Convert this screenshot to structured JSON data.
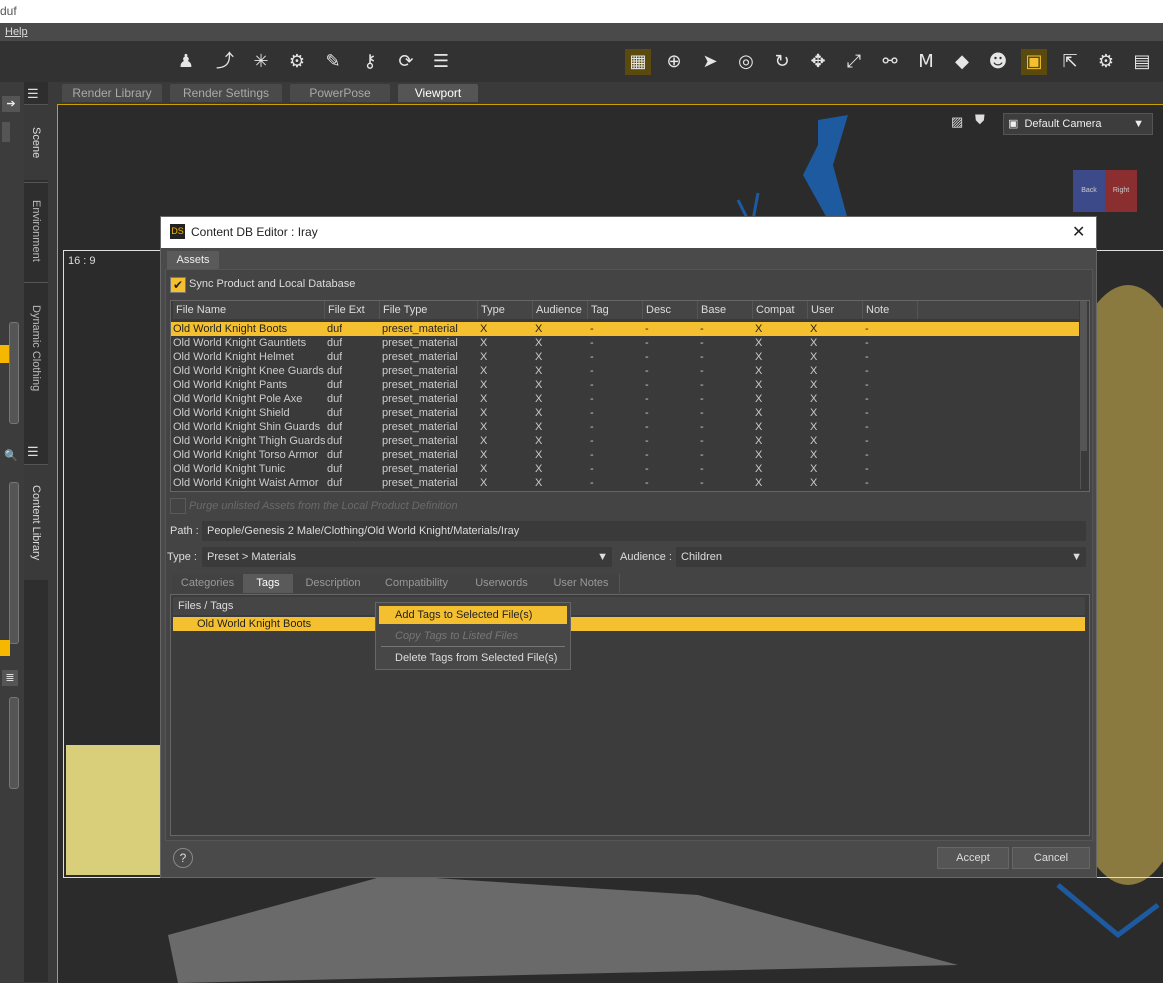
{
  "app": {
    "title_fragment": "duf",
    "menu_help": "Help"
  },
  "toolbar_icons": [
    "figure-add-icon",
    "bone-tool-icon",
    "light-sparkle-icon",
    "gear-light-icon",
    "pin-tool-icon",
    "joint-editor-icon",
    "target-rotate-icon",
    "align-icon",
    "grid-snap-icon",
    "universal-tool-icon",
    "select-tool-icon",
    "node-rotate-icon",
    "rotate-icon",
    "translate-icon",
    "scale-icon",
    "bone-select-icon",
    "geometry-editor-icon",
    "region-navigator-icon",
    "surface-select-icon",
    "camera-tool-icon",
    "node-select-icon",
    "tool-settings-icon",
    "render-icon"
  ],
  "left_tabs": [
    "Scene",
    "Environment",
    "Dynamic Clothing",
    "Content Library"
  ],
  "main_tabs": [
    {
      "label": "Render Library"
    },
    {
      "label": "Render Settings"
    },
    {
      "label": "PowerPose"
    },
    {
      "label": "Viewport"
    }
  ],
  "viewport": {
    "aspect_label": "16 : 9",
    "camera": "Default Camera",
    "cube_left": "Back",
    "cube_right": "Right"
  },
  "dialog": {
    "title": "Content DB Editor : Iray",
    "logo": "DS",
    "tab": "Assets",
    "sync_label": "Sync Product and Local Database",
    "columns": [
      "File Name",
      "File Ext",
      "File Type",
      "Type",
      "Audience",
      "Tag",
      "Desc",
      "Base",
      "Compat",
      "User",
      "Note"
    ],
    "rows": [
      [
        "Old World Knight Boots",
        "duf",
        "preset_material",
        "X",
        "X",
        "-",
        "-",
        "-",
        "X",
        "X",
        "-"
      ],
      [
        "Old World Knight Gauntlets",
        "duf",
        "preset_material",
        "X",
        "X",
        "-",
        "-",
        "-",
        "X",
        "X",
        "-"
      ],
      [
        "Old World Knight Helmet",
        "duf",
        "preset_material",
        "X",
        "X",
        "-",
        "-",
        "-",
        "X",
        "X",
        "-"
      ],
      [
        "Old World Knight Knee Guards",
        "duf",
        "preset_material",
        "X",
        "X",
        "-",
        "-",
        "-",
        "X",
        "X",
        "-"
      ],
      [
        "Old World Knight Pants",
        "duf",
        "preset_material",
        "X",
        "X",
        "-",
        "-",
        "-",
        "X",
        "X",
        "-"
      ],
      [
        "Old World Knight Pole Axe",
        "duf",
        "preset_material",
        "X",
        "X",
        "-",
        "-",
        "-",
        "X",
        "X",
        "-"
      ],
      [
        "Old World Knight Shield",
        "duf",
        "preset_material",
        "X",
        "X",
        "-",
        "-",
        "-",
        "X",
        "X",
        "-"
      ],
      [
        "Old World Knight Shin Guards",
        "duf",
        "preset_material",
        "X",
        "X",
        "-",
        "-",
        "-",
        "X",
        "X",
        "-"
      ],
      [
        "Old World Knight Thigh Guards",
        "duf",
        "preset_material",
        "X",
        "X",
        "-",
        "-",
        "-",
        "X",
        "X",
        "-"
      ],
      [
        "Old World Knight Torso Armor",
        "duf",
        "preset_material",
        "X",
        "X",
        "-",
        "-",
        "-",
        "X",
        "X",
        "-"
      ],
      [
        "Old World Knight Tunic",
        "duf",
        "preset_material",
        "X",
        "X",
        "-",
        "-",
        "-",
        "X",
        "X",
        "-"
      ],
      [
        "Old World Knight Waist Armor",
        "duf",
        "preset_material",
        "X",
        "X",
        "-",
        "-",
        "-",
        "X",
        "X",
        "-"
      ]
    ],
    "selected_row": 0,
    "purge_label": "Purge unlisted Assets from the Local Product Definition",
    "path_label": "Path :",
    "path_value": "People/Genesis 2 Male/Clothing/Old World Knight/Materials/Iray",
    "type_label": "Type :",
    "type_value": "Preset > Materials",
    "audience_label": "Audience :",
    "audience_value": "Children",
    "subtabs": [
      "Categories",
      "Tags",
      "Description",
      "Compatibility",
      "Userwords",
      "User Notes"
    ],
    "active_subtab": "Tags",
    "files_tags_header": "Files / Tags",
    "files_tags_item": "Old World Knight Boots",
    "accept": "Accept",
    "cancel": "Cancel"
  },
  "context_menu": {
    "items": [
      {
        "label": "Add Tags to Selected File(s)",
        "state": "highlighted"
      },
      {
        "label": "Copy Tags to Listed Files",
        "state": "disabled"
      },
      {
        "label": "Delete Tags from Selected File(s)",
        "state": "normal"
      }
    ]
  },
  "colors": {
    "accent": "#f5c030",
    "dialog_bg": "#4a4a4a",
    "viewport_bg": "#2b2b2b",
    "selection": "#f5c030"
  }
}
